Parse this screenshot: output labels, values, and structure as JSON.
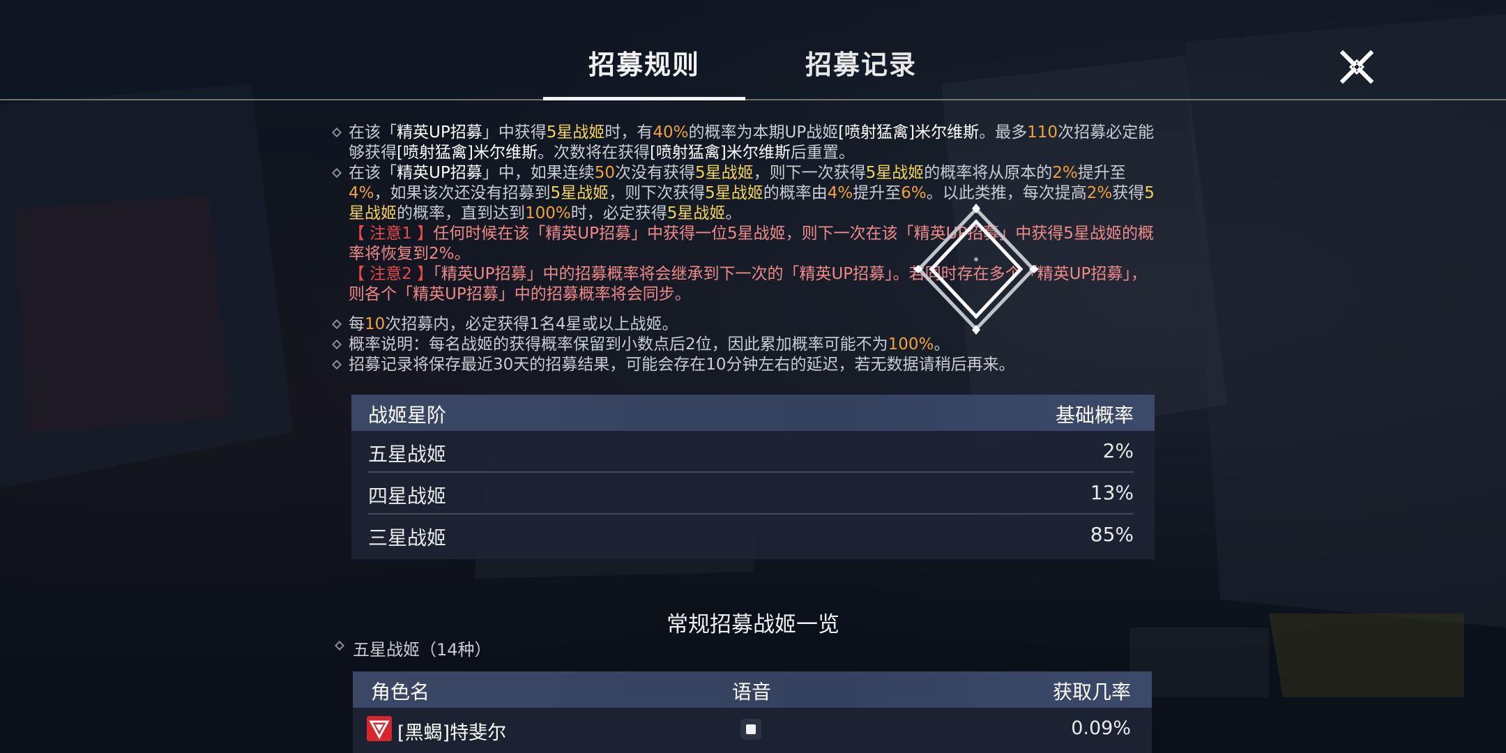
{
  "tabs": [
    {
      "label": "招募规则",
      "active": true
    },
    {
      "label": "招募记录",
      "active": false
    }
  ],
  "rules": {
    "r1": {
      "a": "在该「",
      "b": "精英UP招募",
      "c": "」中获得",
      "d": "5星战姬",
      "e": "时，有",
      "f": "40%",
      "g": "的概率为本期UP战姬",
      "h": "[喷射猛禽]米尔维斯",
      "i": "。最多",
      "j": "110",
      "k": "次招募必定能够获得",
      "l": "[喷射猛禽]米尔维斯",
      "m": "。次数将在获得",
      "n": "[喷射猛禽]米尔维斯",
      "o": "后重置。"
    },
    "r2": {
      "a": "在该「",
      "b": "精英UP招募",
      "c": "」中，如果连续",
      "d": "50",
      "e": "次没有获得",
      "f": "5星战姬",
      "g": "，则下一次获得",
      "h": "5星战姬",
      "i": "的概率将从原本的",
      "j": "2%",
      "k": "提升至",
      "l": "4%",
      "m": "，如果该次还没有招募到",
      "n": "5星战姬",
      "o": "，则下次获得",
      "p": "5星战姬",
      "q": "的概率由",
      "r": "4%",
      "s": "提升至",
      "t": "6%",
      "u": "。以此类推，每次提高",
      "v": "2%",
      "w": "获得",
      "x": "5星战姬",
      "y": "的概率，直到达到",
      "z": "100%",
      "aa": "时，必定获得",
      "ab": "5星战姬",
      "ac": "。"
    },
    "note1": {
      "tag": "【 注意1 】",
      "text": "任何时候在该「精英UP招募」中获得一位5星战姬，则下一次在该「精英UP招募」中获得5星战姬的概率将恢复到2%。"
    },
    "note2": {
      "tag": "【 注意2 】",
      "text": "「精英UP招募」中的招募概率将会继承到下一次的「精英UP招募」。若同时存在多个「精英UP招募」，则各个「精英UP招募」中的招募概率将会同步。"
    },
    "r3": {
      "a": "每",
      "b": "10",
      "c": "次招募内，必定获得1名4星或以上战姬。"
    },
    "r4": {
      "a": "概率说明：每名战姬的获得概率保留到小数点后2位，因此累加概率可能不为",
      "b": "100%",
      "c": "。"
    },
    "r5": {
      "a": "招募记录将保存最近30天的招募结果，可能会存在10分钟左右的延迟，若无数据请稍后再来。"
    }
  },
  "rate_table": {
    "header": {
      "col1": "战姬星阶",
      "col2": "基础概率"
    },
    "rows": [
      {
        "name": "五星战姬",
        "rate": "2%"
      },
      {
        "name": "四星战姬",
        "rate": "13%"
      },
      {
        "name": "三星战姬",
        "rate": "85%"
      }
    ]
  },
  "section": {
    "title": "常规招募战姬一览",
    "subhead": "五星战姬（14种）"
  },
  "char_table": {
    "header": {
      "col1": "角色名",
      "col2": "语音",
      "col3": "获取几率"
    },
    "rows": [
      {
        "name": "[黑蝎]特斐尔",
        "rate": "0.09%",
        "icon": "faction-badge-icon"
      }
    ]
  },
  "colors": {
    "highlight_yellow": "#f3d35a",
    "highlight_orange": "#f0a23c",
    "note_red": "#e94a4a",
    "note_text": "#ef8a88",
    "table_header": "#3a4866"
  },
  "icons": {
    "close": "close-x-icon",
    "bullet": "diamond-bullet-icon",
    "loading": "loading-diamond-icon",
    "voice": "voice-play-icon"
  }
}
